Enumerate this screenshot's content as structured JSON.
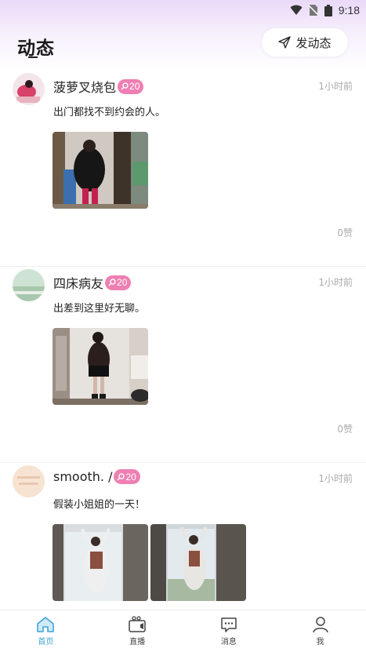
{
  "status_bar": {
    "time": "9:18"
  },
  "header": {
    "title": "动态",
    "post_button": "发动态"
  },
  "posts": [
    {
      "name": "菠萝叉烧包",
      "badge": "20",
      "time": "1小时前",
      "content": "出门都找不到约会的人。",
      "likes": "0赞"
    },
    {
      "name": "四床病友",
      "badge": "20",
      "time": "1小时前",
      "content": "出差到这里好无聊。",
      "likes": "0赞"
    },
    {
      "name": "smooth. /",
      "badge": "20",
      "time": "1小时前",
      "content": "假装小姐姐的一天！",
      "likes": ""
    }
  ],
  "tabbar": {
    "items": [
      {
        "label": "首页",
        "icon": "home-icon"
      },
      {
        "label": "直播",
        "icon": "live-tv-icon"
      },
      {
        "label": "消息",
        "icon": "message-icon"
      },
      {
        "label": "我",
        "icon": "user-icon"
      }
    ]
  },
  "colors": {
    "badge": "#ee7fb2",
    "tab_active": "#3fa3d8",
    "header_gradient": "#e9d9f7"
  }
}
